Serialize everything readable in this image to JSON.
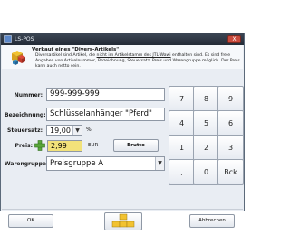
{
  "window": {
    "title": "LS-POS",
    "close_label": "X"
  },
  "header": {
    "title": "Verkauf eines \"Divers-Artikels\"",
    "text_before": "Diversartikel sind Artikel, die ",
    "text_underlined": "nicht im Artikelstamm des JTL-Wawi",
    "text_after": " enthalten sind. Es sind freie Angaben von Artikelnummer, Bezeichnung, Steuersatz, Preis und Warengruppe möglich. Der Preis kann auch netto sein."
  },
  "form": {
    "nummer_label": "Nummer:",
    "nummer_value": "999-999-999",
    "bezeichnung_label": "Bezeichnung:",
    "bezeichnung_value": "Schlüsselanhänger \"Pferd\"",
    "steuersatz_label": "Steuersatz:",
    "steuersatz_value": "19,00",
    "steuersatz_unit": "%",
    "preis_label": "Preis:",
    "preis_value": "2,99",
    "preis_currency": "EUR",
    "brutto_label": "Brutto",
    "warengruppe_label": "Warengruppe:",
    "warengruppe_value": "Preisgruppe A"
  },
  "keypad": {
    "keys": [
      "7",
      "8",
      "9",
      "4",
      "5",
      "6",
      "1",
      "2",
      "3",
      ",",
      "0",
      "Bck"
    ]
  },
  "footer": {
    "ok_label": "OK",
    "cancel_label": "Abbrechen"
  }
}
